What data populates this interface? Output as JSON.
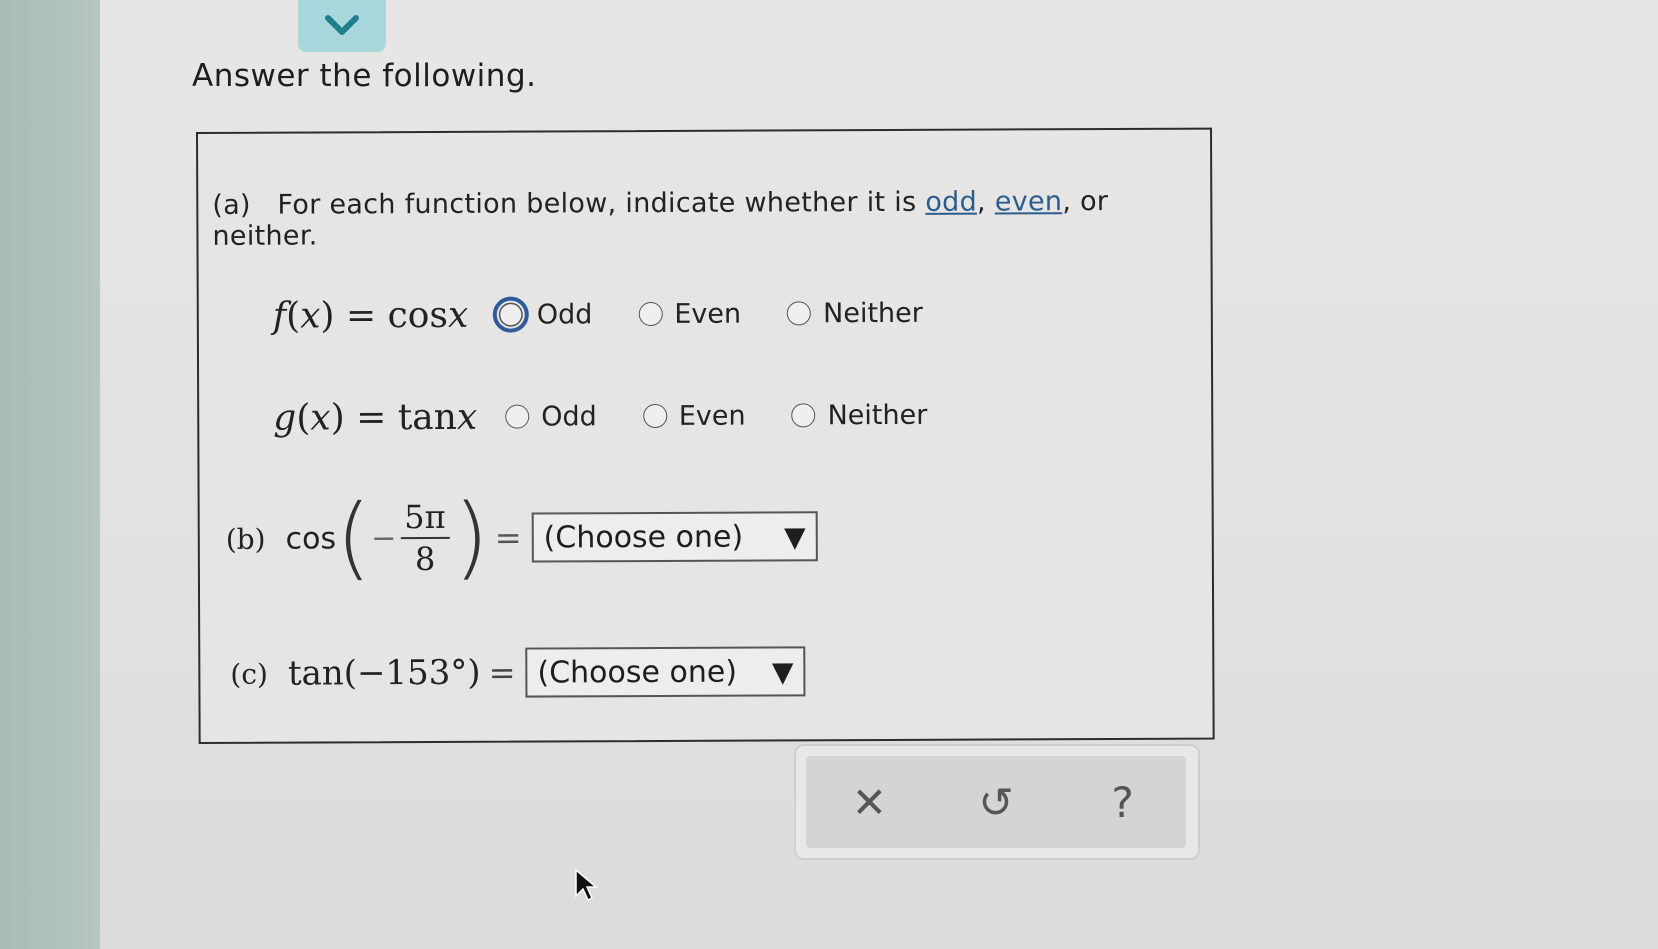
{
  "page": {
    "title": "Answer the following."
  },
  "part_a": {
    "label": "(a)",
    "prompt_start": "For each function below, indicate whether it is ",
    "link_odd": "odd",
    "sep1": ", ",
    "link_even": "even",
    "prompt_end": ", or neither.",
    "rows": [
      {
        "fn": "f",
        "var": "x",
        "rhs": "cos",
        "options": [
          "Odd",
          "Even",
          "Neither"
        ],
        "focused_option": "Odd"
      },
      {
        "fn": "g",
        "var": "x",
        "rhs": "tan",
        "options": [
          "Odd",
          "Even",
          "Neither"
        ],
        "focused_option": null
      }
    ]
  },
  "part_b": {
    "label": "(b)",
    "func": "cos",
    "minus": "−",
    "numerator": "5π",
    "denominator": "8",
    "equals": "=",
    "dropdown": "(Choose one)"
  },
  "part_c": {
    "label": "(c)",
    "expr": "tan(−153°)",
    "equals": "=",
    "dropdown": "(Choose one)"
  },
  "toolbar": {
    "clear_icon": "✕",
    "undo_icon": "↺",
    "help_icon": "?"
  },
  "colors": {
    "link": "#2a5d8f",
    "focus": "#2d5b9c",
    "tab": "#a9d8dc"
  }
}
